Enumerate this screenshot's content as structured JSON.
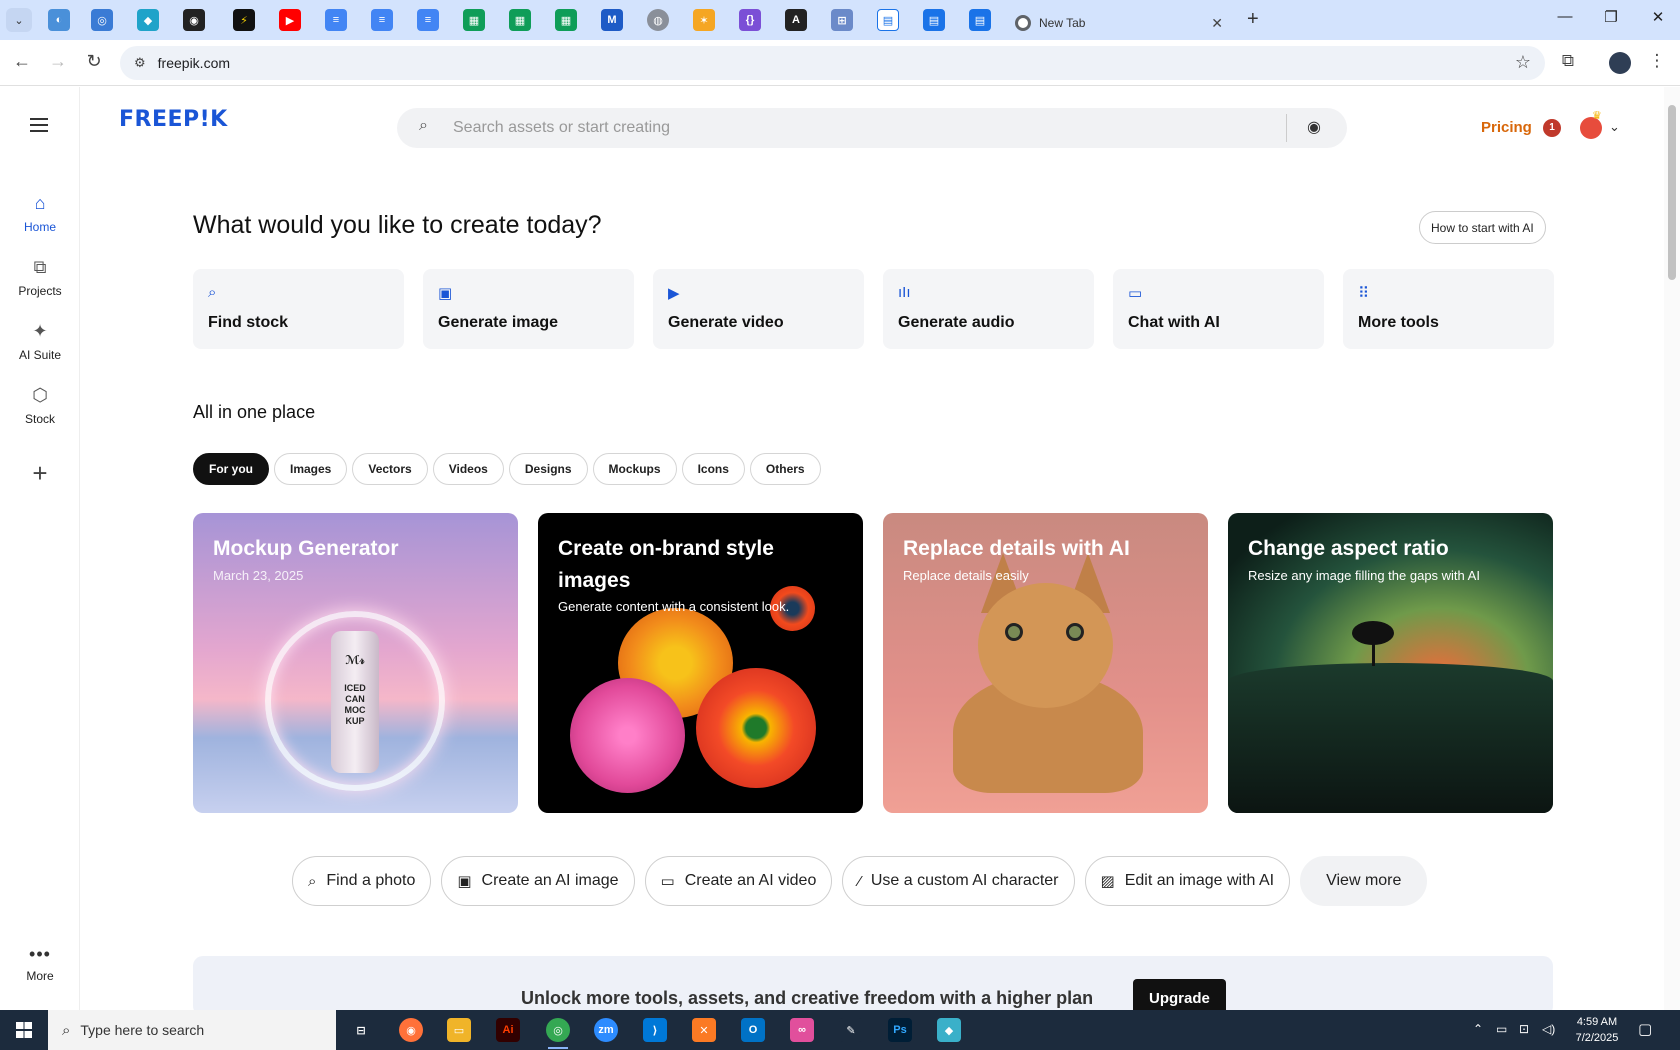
{
  "browser": {
    "active_tab_title": "New Tab",
    "url": "freepik.com",
    "new_tab_symbol": "+",
    "tab_close_symbol": "✕",
    "win_minimize": "—",
    "win_restore": "❐",
    "win_close": "✕"
  },
  "header": {
    "logo_text": "FREEP!K",
    "search_placeholder": "Search assets or start creating",
    "pricing_label": "Pricing",
    "notification_count": "1"
  },
  "sidebar": {
    "items": [
      {
        "label": "Home",
        "icon": "home-icon"
      },
      {
        "label": "Projects",
        "icon": "projects-icon"
      },
      {
        "label": "AI Suite",
        "icon": "sparkle-icon"
      },
      {
        "label": "Stock",
        "icon": "stock-icon"
      }
    ],
    "more_label": "More",
    "add_symbol": "+"
  },
  "hero": {
    "title": "What would you like to create today?",
    "howto_label": "How to start with AI"
  },
  "actions": [
    {
      "label": "Find stock",
      "icon": "search-icon"
    },
    {
      "label": "Generate image",
      "icon": "image-icon"
    },
    {
      "label": "Generate video",
      "icon": "video-icon"
    },
    {
      "label": "Generate audio",
      "icon": "audio-icon"
    },
    {
      "label": "Chat with AI",
      "icon": "chat-icon"
    },
    {
      "label": "More tools",
      "icon": "grid-icon"
    }
  ],
  "section": {
    "title": "All in one place",
    "chips": [
      "For you",
      "Images",
      "Vectors",
      "Videos",
      "Designs",
      "Mockups",
      "Icons",
      "Others"
    ],
    "selected_chip": "For you"
  },
  "features": [
    {
      "title": "Mockup Generator",
      "subtitle": "March 23, 2025",
      "can_text": "ICED CAN MOC KUP",
      "can_logo": "ℳ𝓇"
    },
    {
      "title": "Create on-brand style images",
      "subtitle": "Generate content with a consistent look."
    },
    {
      "title": "Replace details with AI",
      "subtitle": "Replace details easily"
    },
    {
      "title": "Change aspect ratio",
      "subtitle": "Resize any image filling the gaps with AI"
    }
  ],
  "quick_actions": [
    {
      "label": "Find a photo",
      "icon": "search-icon"
    },
    {
      "label": "Create an AI image",
      "icon": "ai-image-icon"
    },
    {
      "label": "Create an AI video",
      "icon": "video-camera-icon"
    },
    {
      "label": "Use a custom AI character",
      "icon": "magic-wand-icon"
    },
    {
      "label": "Edit an image with AI",
      "icon": "edit-image-icon"
    }
  ],
  "view_more_label": "View more",
  "banner": {
    "text": "Unlock more tools, assets, and creative freedom with a higher plan",
    "button_label": "Upgrade"
  },
  "taskbar": {
    "search_placeholder": "Type here to search",
    "time": "4:59 AM",
    "date": "7/2/2025"
  },
  "colors": {
    "brand_blue": "#1a55d6",
    "pricing_orange": "#d8670a",
    "taskbar": "#1c2b3d"
  }
}
